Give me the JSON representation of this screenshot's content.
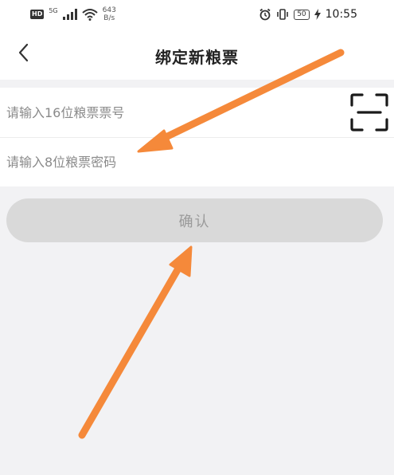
{
  "status_bar": {
    "hd_badge": "HD",
    "network_type": "5G",
    "net_speed_value": "643",
    "net_speed_unit": "B/s",
    "battery_level": "50",
    "time": "10:55"
  },
  "nav": {
    "title": "绑定新粮票"
  },
  "form": {
    "ticket_number_placeholder": "请输入16位粮票票号",
    "ticket_password_placeholder": "请输入8位粮票密码"
  },
  "confirm_button": {
    "label": "确认"
  },
  "colors": {
    "annotation_arrow": "#f5893a",
    "button_disabled_bg": "#d9d9d9",
    "page_bg": "#f2f2f4"
  }
}
